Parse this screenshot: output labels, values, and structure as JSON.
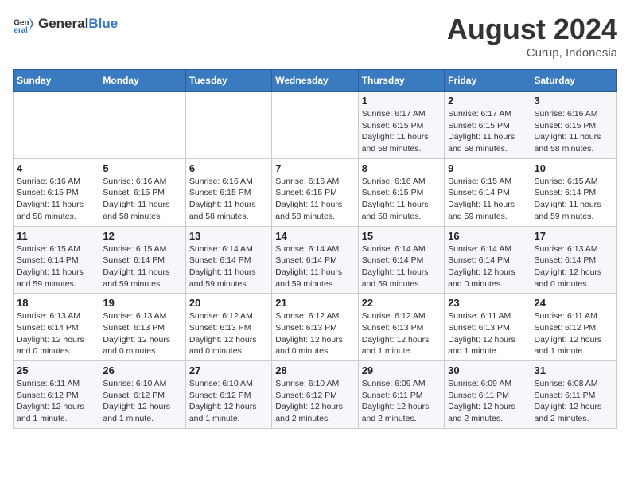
{
  "header": {
    "logo_general": "General",
    "logo_blue": "Blue",
    "month_year": "August 2024",
    "location": "Curup, Indonesia"
  },
  "weekdays": [
    "Sunday",
    "Monday",
    "Tuesday",
    "Wednesday",
    "Thursday",
    "Friday",
    "Saturday"
  ],
  "weeks": [
    [
      {
        "day": "",
        "info": ""
      },
      {
        "day": "",
        "info": ""
      },
      {
        "day": "",
        "info": ""
      },
      {
        "day": "",
        "info": ""
      },
      {
        "day": "1",
        "info": "Sunrise: 6:17 AM\nSunset: 6:15 PM\nDaylight: 11 hours\nand 58 minutes."
      },
      {
        "day": "2",
        "info": "Sunrise: 6:17 AM\nSunset: 6:15 PM\nDaylight: 11 hours\nand 58 minutes."
      },
      {
        "day": "3",
        "info": "Sunrise: 6:16 AM\nSunset: 6:15 PM\nDaylight: 11 hours\nand 58 minutes."
      }
    ],
    [
      {
        "day": "4",
        "info": "Sunrise: 6:16 AM\nSunset: 6:15 PM\nDaylight: 11 hours\nand 58 minutes."
      },
      {
        "day": "5",
        "info": "Sunrise: 6:16 AM\nSunset: 6:15 PM\nDaylight: 11 hours\nand 58 minutes."
      },
      {
        "day": "6",
        "info": "Sunrise: 6:16 AM\nSunset: 6:15 PM\nDaylight: 11 hours\nand 58 minutes."
      },
      {
        "day": "7",
        "info": "Sunrise: 6:16 AM\nSunset: 6:15 PM\nDaylight: 11 hours\nand 58 minutes."
      },
      {
        "day": "8",
        "info": "Sunrise: 6:16 AM\nSunset: 6:15 PM\nDaylight: 11 hours\nand 58 minutes."
      },
      {
        "day": "9",
        "info": "Sunrise: 6:15 AM\nSunset: 6:14 PM\nDaylight: 11 hours\nand 59 minutes."
      },
      {
        "day": "10",
        "info": "Sunrise: 6:15 AM\nSunset: 6:14 PM\nDaylight: 11 hours\nand 59 minutes."
      }
    ],
    [
      {
        "day": "11",
        "info": "Sunrise: 6:15 AM\nSunset: 6:14 PM\nDaylight: 11 hours\nand 59 minutes."
      },
      {
        "day": "12",
        "info": "Sunrise: 6:15 AM\nSunset: 6:14 PM\nDaylight: 11 hours\nand 59 minutes."
      },
      {
        "day": "13",
        "info": "Sunrise: 6:14 AM\nSunset: 6:14 PM\nDaylight: 11 hours\nand 59 minutes."
      },
      {
        "day": "14",
        "info": "Sunrise: 6:14 AM\nSunset: 6:14 PM\nDaylight: 11 hours\nand 59 minutes."
      },
      {
        "day": "15",
        "info": "Sunrise: 6:14 AM\nSunset: 6:14 PM\nDaylight: 11 hours\nand 59 minutes."
      },
      {
        "day": "16",
        "info": "Sunrise: 6:14 AM\nSunset: 6:14 PM\nDaylight: 12 hours\nand 0 minutes."
      },
      {
        "day": "17",
        "info": "Sunrise: 6:13 AM\nSunset: 6:14 PM\nDaylight: 12 hours\nand 0 minutes."
      }
    ],
    [
      {
        "day": "18",
        "info": "Sunrise: 6:13 AM\nSunset: 6:14 PM\nDaylight: 12 hours\nand 0 minutes."
      },
      {
        "day": "19",
        "info": "Sunrise: 6:13 AM\nSunset: 6:13 PM\nDaylight: 12 hours\nand 0 minutes."
      },
      {
        "day": "20",
        "info": "Sunrise: 6:12 AM\nSunset: 6:13 PM\nDaylight: 12 hours\nand 0 minutes."
      },
      {
        "day": "21",
        "info": "Sunrise: 6:12 AM\nSunset: 6:13 PM\nDaylight: 12 hours\nand 0 minutes."
      },
      {
        "day": "22",
        "info": "Sunrise: 6:12 AM\nSunset: 6:13 PM\nDaylight: 12 hours\nand 1 minute."
      },
      {
        "day": "23",
        "info": "Sunrise: 6:11 AM\nSunset: 6:13 PM\nDaylight: 12 hours\nand 1 minute."
      },
      {
        "day": "24",
        "info": "Sunrise: 6:11 AM\nSunset: 6:12 PM\nDaylight: 12 hours\nand 1 minute."
      }
    ],
    [
      {
        "day": "25",
        "info": "Sunrise: 6:11 AM\nSunset: 6:12 PM\nDaylight: 12 hours\nand 1 minute."
      },
      {
        "day": "26",
        "info": "Sunrise: 6:10 AM\nSunset: 6:12 PM\nDaylight: 12 hours\nand 1 minute."
      },
      {
        "day": "27",
        "info": "Sunrise: 6:10 AM\nSunset: 6:12 PM\nDaylight: 12 hours\nand 1 minute."
      },
      {
        "day": "28",
        "info": "Sunrise: 6:10 AM\nSunset: 6:12 PM\nDaylight: 12 hours\nand 2 minutes."
      },
      {
        "day": "29",
        "info": "Sunrise: 6:09 AM\nSunset: 6:11 PM\nDaylight: 12 hours\nand 2 minutes."
      },
      {
        "day": "30",
        "info": "Sunrise: 6:09 AM\nSunset: 6:11 PM\nDaylight: 12 hours\nand 2 minutes."
      },
      {
        "day": "31",
        "info": "Sunrise: 6:08 AM\nSunset: 6:11 PM\nDaylight: 12 hours\nand 2 minutes."
      }
    ]
  ]
}
